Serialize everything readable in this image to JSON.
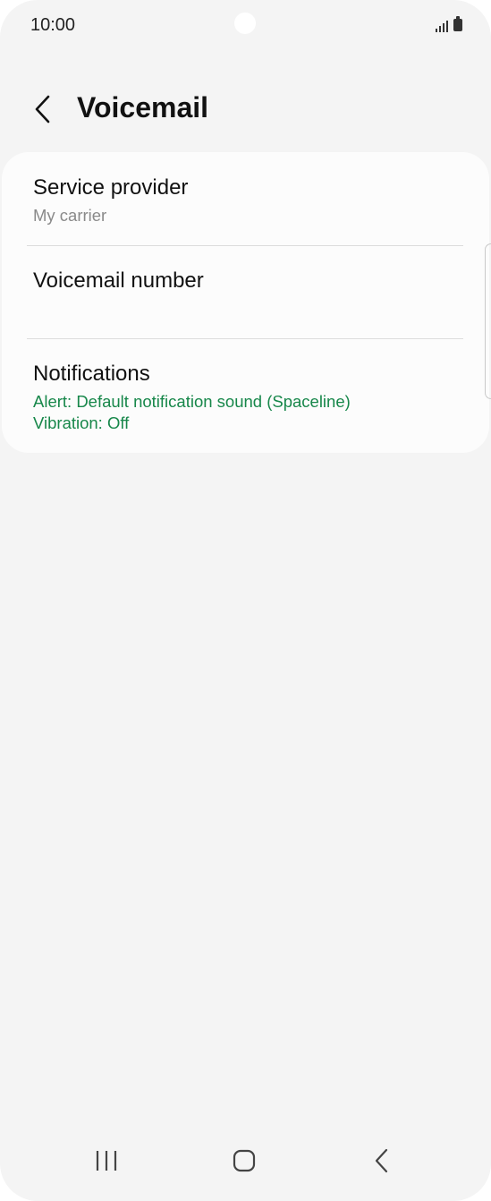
{
  "status_bar": {
    "time": "10:00",
    "icons": [
      "signal-icon",
      "battery-icon"
    ]
  },
  "header": {
    "back_icon": "chevron-left-icon",
    "title": "Voicemail"
  },
  "settings": [
    {
      "title": "Service provider",
      "subtitle": "My carrier"
    },
    {
      "title": "Voicemail number"
    },
    {
      "title": "Notifications",
      "subtitle_lines": [
        "Alert: Default notification sound (Spaceline)",
        "Vibration: Off"
      ]
    }
  ],
  "colors": {
    "background": "#f4f4f4",
    "card": "#fcfcfc",
    "accent_green": "#17874a",
    "secondary_text": "#8a8a8a"
  },
  "nav_bar": {
    "icons": [
      "recent-apps-icon",
      "home-icon",
      "back-icon"
    ]
  }
}
